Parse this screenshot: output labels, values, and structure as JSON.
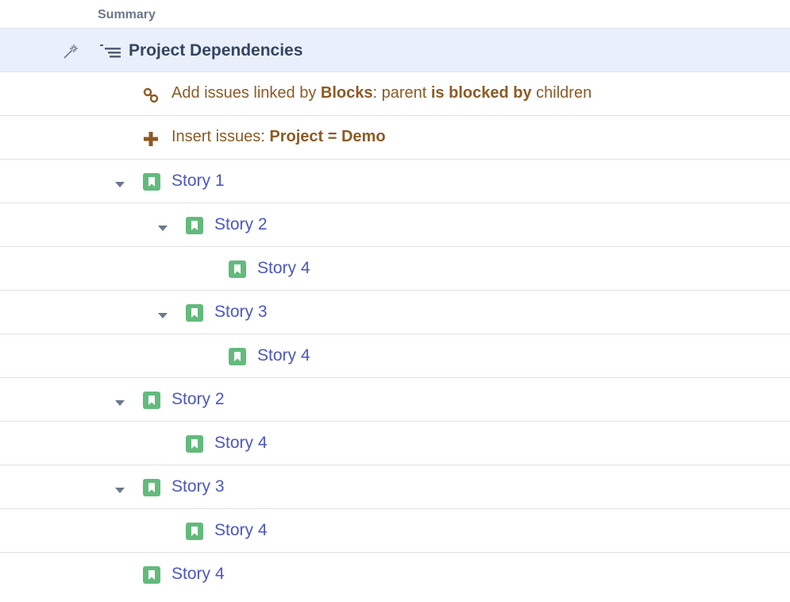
{
  "header": {
    "column_label": "Summary"
  },
  "title_row": {
    "title": "Project Dependencies"
  },
  "generators": [
    {
      "icon": "link-icon",
      "prefix": "Add issues linked by ",
      "bold1": "Blocks",
      "middle": ": parent ",
      "bold2": "is blocked by",
      "suffix": " children"
    },
    {
      "icon": "plus-icon",
      "prefix": "Insert issues: ",
      "bold1": "Project = Demo"
    }
  ],
  "rows": [
    {
      "label": "Story 1",
      "level": 0,
      "expanded": true
    },
    {
      "label": "Story 2",
      "level": 1,
      "expanded": true
    },
    {
      "label": "Story 4",
      "level": 2,
      "expanded": false
    },
    {
      "label": "Story 3",
      "level": 1,
      "expanded": true
    },
    {
      "label": "Story 4",
      "level": 2,
      "expanded": false
    },
    {
      "label": "Story 2",
      "level": 0,
      "expanded": true
    },
    {
      "label": "Story 4",
      "level": 1,
      "expanded": false
    },
    {
      "label": "Story 3",
      "level": 0,
      "expanded": true
    },
    {
      "label": "Story 4",
      "level": 1,
      "expanded": false
    },
    {
      "label": "Story 4",
      "level": 0,
      "expanded": false
    }
  ],
  "colors": {
    "accent_link": "#4b57c4",
    "generator_text": "#8d5a24",
    "story_icon": "#63ba7c",
    "title_row_bg": "#e9f0fb"
  }
}
